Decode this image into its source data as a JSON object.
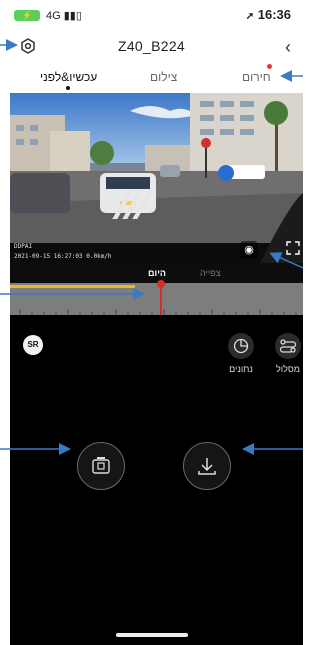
{
  "status_bar": {
    "battery_label": "",
    "network": "4G",
    "time": "16:36"
  },
  "header": {
    "title": "Z40_B224"
  },
  "tabs": [
    {
      "label": "חירום"
    },
    {
      "label": "צילום"
    },
    {
      "label": "עכשיו&לפני"
    }
  ],
  "camera": {
    "overlay_line1": "DDPAI",
    "overlay_line2": "2021-09-15   16:27:03   0.0km/h"
  },
  "timeline": {
    "label_today": "היום",
    "label_watch": "צפייה"
  },
  "controls": {
    "badge": "SR",
    "route_label": "מסלול",
    "data_label": "נתונים"
  },
  "colors": {
    "annotation_arrow": "#3a78c8",
    "timeline_progress": "#e2b93b",
    "timeline_needle": "#d32f2f",
    "emergency_dot": "#e53935"
  }
}
